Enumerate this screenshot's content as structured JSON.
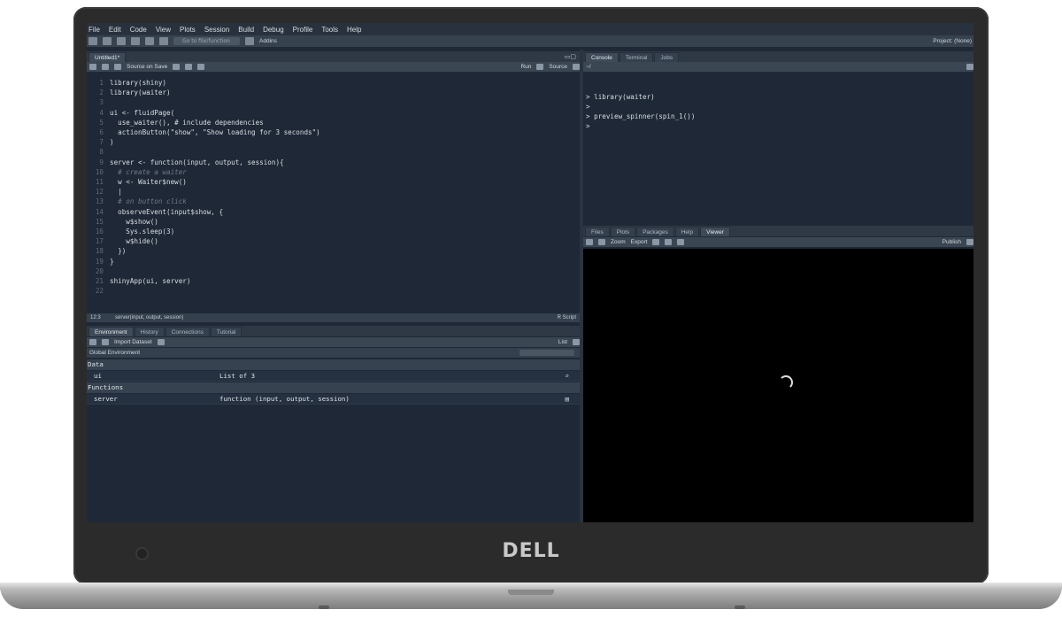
{
  "device": {
    "brand": "DELL"
  },
  "menubar": [
    "File",
    "Edit",
    "Code",
    "View",
    "Plots",
    "Session",
    "Build",
    "Debug",
    "Profile",
    "Tools",
    "Help"
  ],
  "toolbar": {
    "goto_placeholder": "Go to file/function",
    "addins": "Addins",
    "project": "Project: (None)"
  },
  "source_pane": {
    "tab": "Untitled1*",
    "source_on_save": "Source on Save",
    "run": "Run",
    "source": "Source",
    "lines": [
      {
        "n": "1",
        "text": "library(shiny)",
        "comment": false
      },
      {
        "n": "2",
        "text": "library(waiter)",
        "comment": false
      },
      {
        "n": "3",
        "text": "",
        "comment": false
      },
      {
        "n": "4",
        "text": "ui <- fluidPage(",
        "comment": false
      },
      {
        "n": "5",
        "text": "  use_waiter(), # include dependencies",
        "comment": false
      },
      {
        "n": "6",
        "text": "  actionButton(\"show\", \"Show loading for 3 seconds\")",
        "comment": false
      },
      {
        "n": "7",
        "text": ")",
        "comment": false
      },
      {
        "n": "8",
        "text": "",
        "comment": false
      },
      {
        "n": "9",
        "text": "server <- function(input, output, session){",
        "comment": false
      },
      {
        "n": "10",
        "text": "  # create a waiter",
        "comment": true
      },
      {
        "n": "11",
        "text": "  w <- Waiter$new()",
        "comment": false
      },
      {
        "n": "12",
        "text": "  |",
        "comment": false
      },
      {
        "n": "13",
        "text": "  # on button click",
        "comment": true
      },
      {
        "n": "14",
        "text": "  observeEvent(input$show, {",
        "comment": false
      },
      {
        "n": "15",
        "text": "    w$show()",
        "comment": false
      },
      {
        "n": "16",
        "text": "    Sys.sleep(3)",
        "comment": false
      },
      {
        "n": "17",
        "text": "    w$hide()",
        "comment": false
      },
      {
        "n": "18",
        "text": "  })",
        "comment": false
      },
      {
        "n": "19",
        "text": "}",
        "comment": false
      },
      {
        "n": "20",
        "text": "",
        "comment": false
      },
      {
        "n": "21",
        "text": "shinyApp(ui, server)",
        "comment": false
      },
      {
        "n": "22",
        "text": "",
        "comment": false
      }
    ],
    "status_pos": "12:3",
    "status_scope": "server(input, output, session)",
    "status_type": "R Script"
  },
  "env_pane": {
    "tabs": [
      "Environment",
      "History",
      "Connections",
      "Tutorial"
    ],
    "import": "Import Dataset",
    "view_mode": "List",
    "scope": "Global Environment",
    "sections": [
      {
        "title": "Data",
        "rows": [
          {
            "name": "ui",
            "value": "List of 3"
          }
        ]
      },
      {
        "title": "Functions",
        "rows": [
          {
            "name": "server",
            "value": "function (input, output, session)"
          }
        ]
      }
    ]
  },
  "console_pane": {
    "tabs": [
      "Console",
      "Terminal",
      "Jobs"
    ],
    "path": "~/",
    "lines": [
      "> library(waiter)",
      ">",
      "> preview_spinner(spin_1())",
      ">"
    ]
  },
  "viewer_pane": {
    "tabs": [
      "Files",
      "Plots",
      "Packages",
      "Help",
      "Viewer"
    ],
    "zoom": "Zoom",
    "export": "Export",
    "publish": "Publish"
  }
}
